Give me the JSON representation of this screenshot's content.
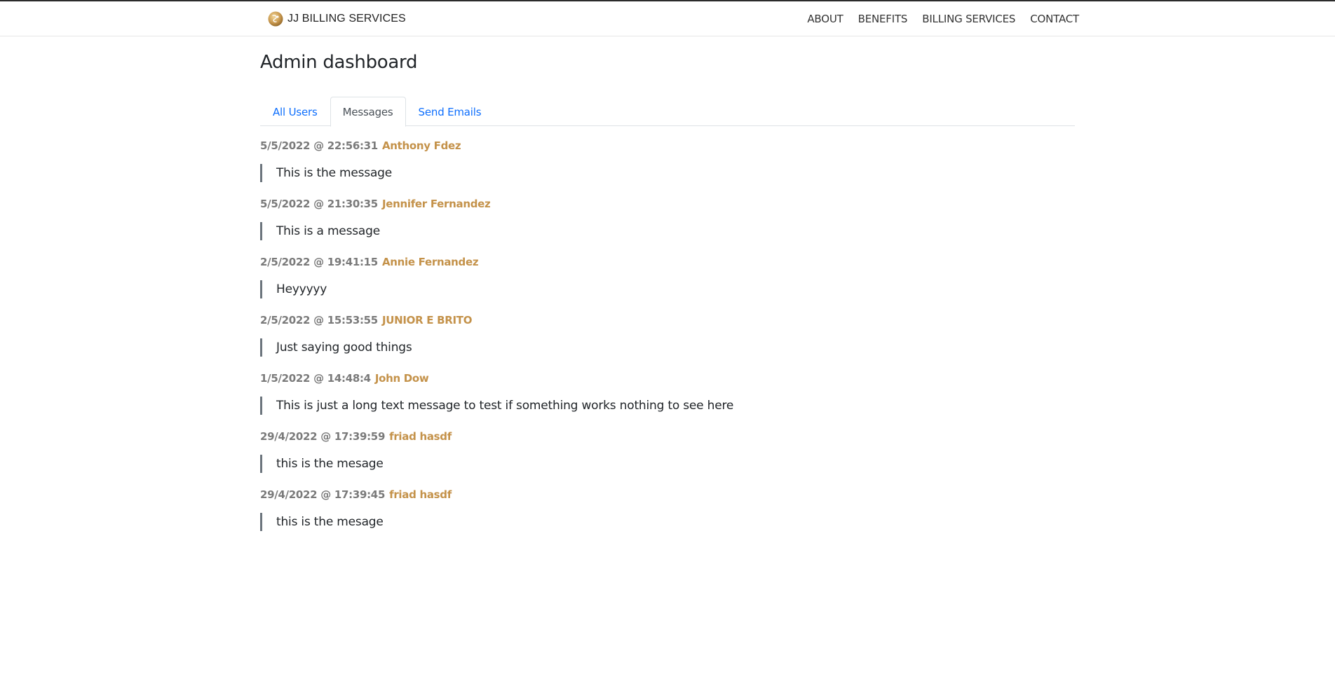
{
  "header": {
    "brand": "JJ BILLING SERVICES",
    "nav": [
      "ABOUT",
      "BENEFITS",
      "BILLING SERVICES",
      "CONTACT"
    ]
  },
  "main": {
    "title": "Admin dashboard",
    "tabs": [
      {
        "label": "All Users",
        "active": false
      },
      {
        "label": "Messages",
        "active": true
      },
      {
        "label": "Send Emails",
        "active": false
      }
    ],
    "messages": [
      {
        "date": "5/5/2022 @ 22:56:31",
        "author": "Anthony Fdez",
        "text": "This is the message"
      },
      {
        "date": "5/5/2022 @ 21:30:35",
        "author": "Jennifer Fernandez",
        "text": "This is a message"
      },
      {
        "date": "2/5/2022 @ 19:41:15",
        "author": "Annie Fernandez",
        "text": "Heyyyyy"
      },
      {
        "date": "2/5/2022 @ 15:53:55",
        "author": "JUNIOR E BRITO",
        "text": "Just saying good things"
      },
      {
        "date": "1/5/2022 @ 14:48:4",
        "author": "John Dow",
        "text": "This is just a long text message to test if something works nothing to see here"
      },
      {
        "date": "29/4/2022 @ 17:39:59",
        "author": "friad hasdf",
        "text": "this is the mesage"
      },
      {
        "date": "29/4/2022 @ 17:39:45",
        "author": "friad hasdf",
        "text": "this is the mesage"
      }
    ]
  },
  "colors": {
    "link": "#0d6efd",
    "author": "#c4924a",
    "date": "#7a7a7a",
    "quote_border": "#6c757d"
  },
  "icons": {
    "brand": "gold-circle-logo-icon"
  }
}
